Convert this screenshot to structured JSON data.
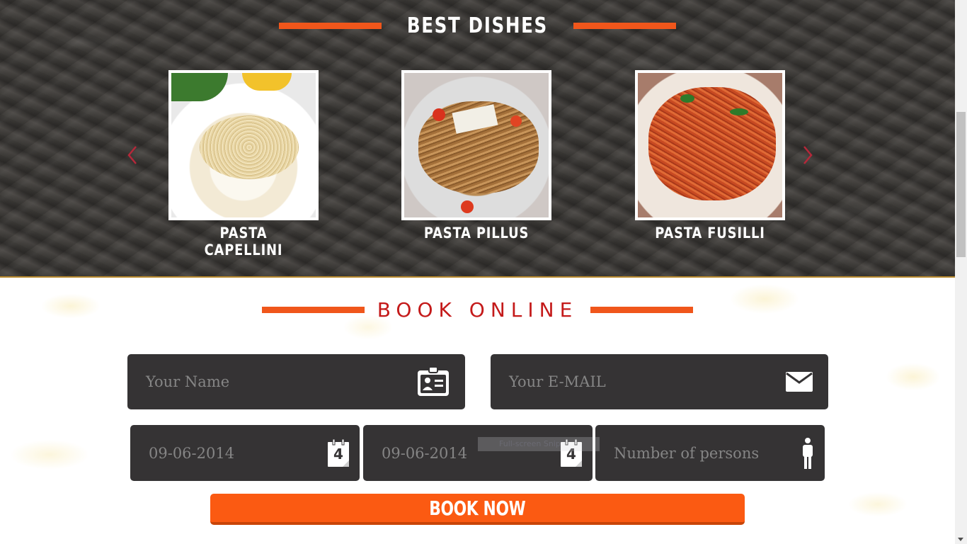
{
  "best_dishes": {
    "title": "BEST DISHES",
    "prev_icon": "chevron-left-icon",
    "next_icon": "chevron-right-icon",
    "accent_color": "#f0561b",
    "items": [
      {
        "name": "PASTA CAPELLINI"
      },
      {
        "name": "PASTA PILLUS"
      },
      {
        "name": "PASTA FUSILLI"
      }
    ]
  },
  "book_online": {
    "title": "BOOK ONLINE",
    "title_color": "#c41a1a",
    "name_placeholder": "Your Name",
    "name_icon": "id-card-icon",
    "email_placeholder": "Your E-MAIL",
    "email_icon": "envelope-icon",
    "date_from": "09-06-2014",
    "date_to": "09-06-2014",
    "date_icon": "calendar-icon",
    "calendar_day": "4",
    "persons_placeholder": "Number of persons",
    "persons_icon": "person-icon",
    "book_button": "BOOK NOW",
    "button_color": "#fb5a12"
  },
  "overlay": {
    "snip_label": "Full-screen Snip"
  }
}
